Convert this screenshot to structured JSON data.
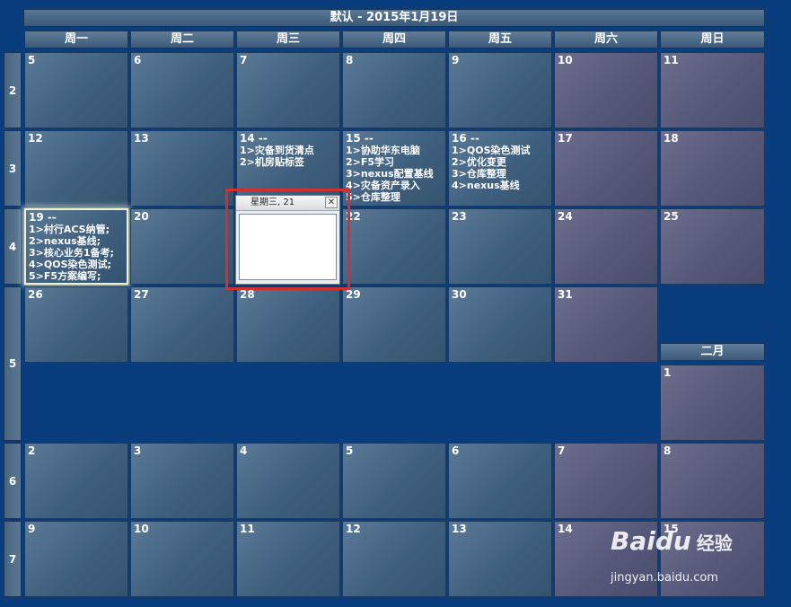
{
  "title": "默认 - 2015年1月19日",
  "weekdays": [
    "周一",
    "周二",
    "周三",
    "周四",
    "周五",
    "周六",
    "周日"
  ],
  "weeks": [
    "2",
    "3",
    "4",
    "5",
    "6",
    "7"
  ],
  "month_label": "二月",
  "days": {
    "w2": [
      "5",
      "6",
      "7",
      "8",
      "9",
      "10",
      "11"
    ],
    "w3": [
      "12",
      "13",
      "14 --",
      "15 --",
      "16 --",
      "17",
      "18"
    ],
    "w4": [
      "19 --",
      "20",
      "21",
      "22",
      "23",
      "24",
      "25"
    ],
    "w5": [
      "26",
      "27",
      "28",
      "29",
      "30",
      "31"
    ],
    "feb1": "1",
    "w6": [
      "2",
      "3",
      "4",
      "5",
      "6",
      "7",
      "8"
    ],
    "w7": [
      "9",
      "10",
      "11",
      "12",
      "13",
      "14",
      "15"
    ]
  },
  "events": {
    "d14": [
      "1>灾备到货清点",
      "2>机房贴标签"
    ],
    "d15": [
      "1>协助华东电脑",
      "2>F5学习",
      "3>nexus配置基线",
      "4>灾备资产录入",
      "5>仓库整理"
    ],
    "d16": [
      "1>QOS染色测试",
      "2>优化变更",
      "3>仓库整理",
      "4>nexus基线"
    ],
    "d19": [
      "1>村行ACS纳管;",
      "2>nexus基线;",
      "3>核心业务1备考;",
      "4>QOS染色测试;",
      "5>F5方案编写;"
    ]
  },
  "popup": {
    "title": "星期三, 21",
    "close": "✕"
  },
  "watermark": {
    "logo": "Baidu",
    "text": "经验",
    "url": "jingyan.baidu.com"
  },
  "colors": {
    "background": "#0a3d7d",
    "highlight": "#d22f2f"
  }
}
